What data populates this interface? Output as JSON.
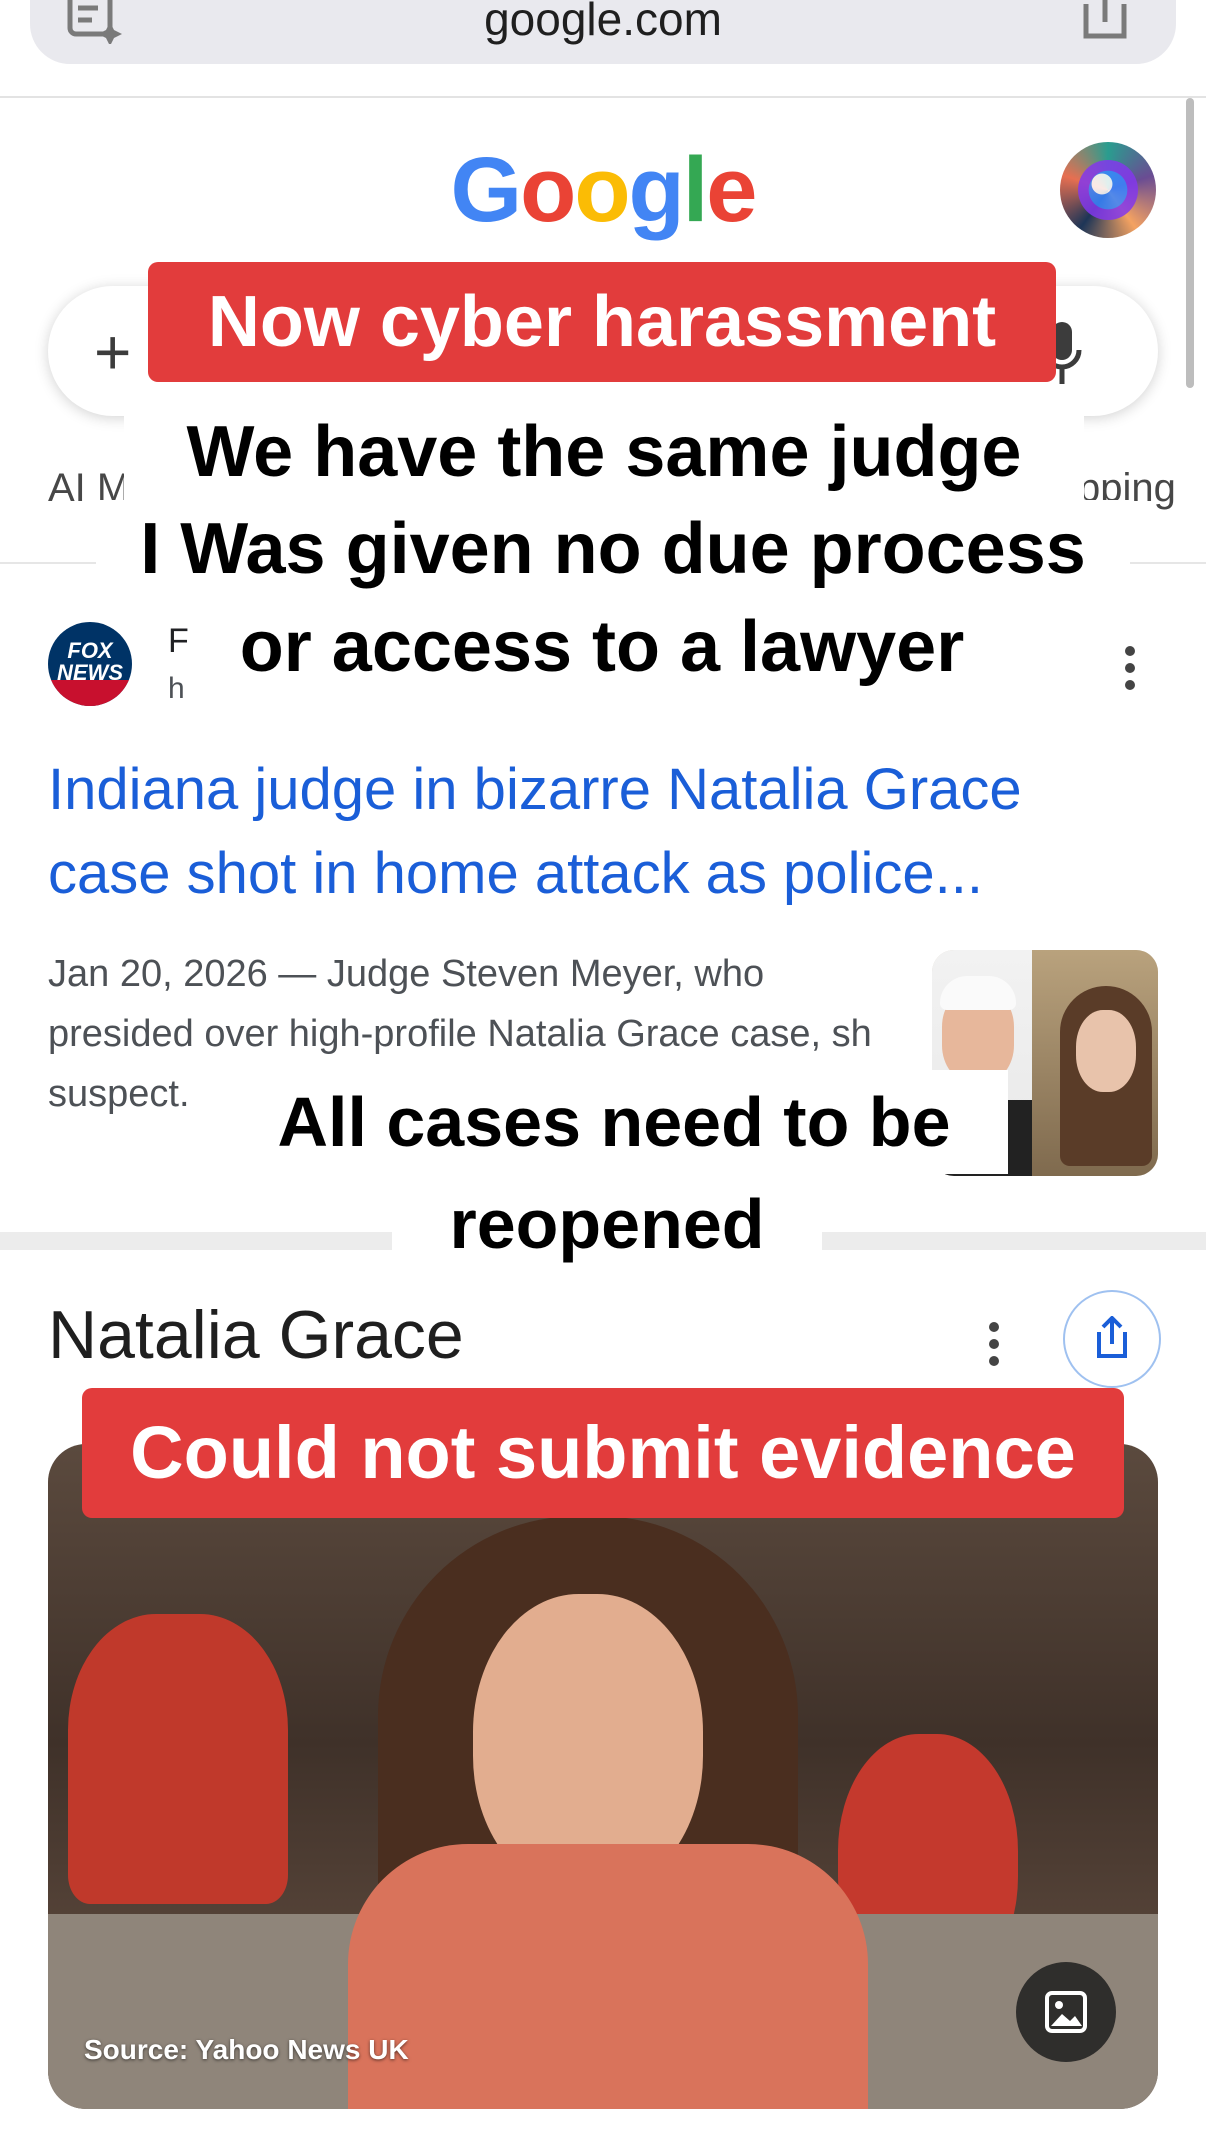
{
  "browser": {
    "url": "google.com"
  },
  "google": {
    "logo_letters": [
      {
        "char": "G",
        "color": "#4285F4"
      },
      {
        "char": "o",
        "color": "#EA4335"
      },
      {
        "char": "o",
        "color": "#FBBC05"
      },
      {
        "char": "g",
        "color": "#4285F4"
      },
      {
        "char": "l",
        "color": "#34A853"
      },
      {
        "char": "e",
        "color": "#EA4335"
      }
    ],
    "plus_symbol": "+",
    "chips": {
      "left_partial": "AI M",
      "right_partial": "pping"
    }
  },
  "news_result": {
    "source_icon": "fox-news-logo",
    "source_logo_text": "FOX NEWS",
    "source_name_partial": "F",
    "source_url_partial": "h",
    "headline": "Indiana judge in bizarre Natalia Grace case shot in home attack as police...",
    "snippet": "Jan 20, 2026 — Judge Steven Meyer, who presided over high-profile Natalia Grace case, sh                     suspect."
  },
  "knowledge_panel": {
    "title": "Natalia Grace",
    "image_caption": "Source: Yahoo News UK"
  },
  "overlays": {
    "cyber": "Now cyber harassment",
    "judge_line1": "We have the same judge",
    "judge_line2": "I Was given no due process",
    "judge_line3": "or access to a lawyer",
    "cases_line1": "All cases need to be",
    "cases_line2": "reopened",
    "evidence": "Could not submit evidence"
  },
  "colors": {
    "link": "#1a5ed8",
    "overlay_red": "#e23c3c"
  }
}
